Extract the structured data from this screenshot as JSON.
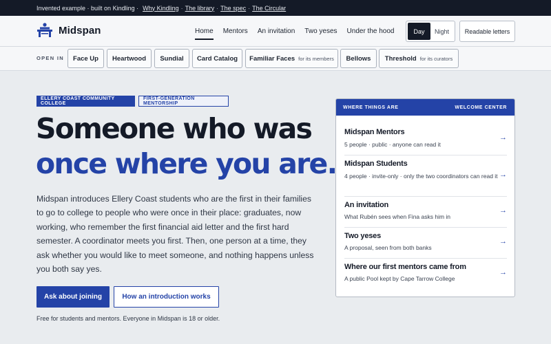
{
  "topbar": {
    "prefix": "Invented example · built on Kindling ·",
    "links": [
      "Why Kindling",
      "The library",
      "The spec",
      "The Circular"
    ],
    "separator": "·"
  },
  "brand": {
    "name": "Midspan",
    "logo_icon": "bench-figure-icon"
  },
  "nav": {
    "items": [
      "Home",
      "Mentors",
      "An invitation",
      "Two yeses",
      "Under the hood"
    ],
    "active": "Home"
  },
  "theme_toggle": {
    "day": "Day",
    "night": "Night",
    "selected": "Day"
  },
  "readable_button": "Readable letters",
  "open_in": {
    "label": "OPEN IN",
    "apps": [
      {
        "name": "Face Up",
        "sub": ""
      },
      {
        "name": "Heartwood",
        "sub": ""
      },
      {
        "name": "Sundial",
        "sub": ""
      },
      {
        "name": "Card Catalog",
        "sub": ""
      },
      {
        "name": "Familiar Faces",
        "sub": "for its members"
      },
      {
        "name": "Bellows",
        "sub": ""
      },
      {
        "name": "Threshold",
        "sub": "for its curators"
      }
    ]
  },
  "hero": {
    "badge_primary": "ELLERY COAST COMMUNITY COLLEGE",
    "badge_secondary": "FIRST-GENERATION MENTORSHIP",
    "headline_line1": "Someone who was",
    "headline_line2": "once where you are.",
    "lead": "Midspan introduces Ellery Coast students who are the first in their families to go to college to people who were once in their place: graduates, now working, who remember the first financial aid letter and the first hard semester. A coordinator meets you first. Then, one person at a time, they ask whether you would like to meet someone, and nothing happens unless you both say yes.",
    "cta_primary": "Ask about joining",
    "cta_secondary": "How an introduction works",
    "fine_print": "Free for students and mentors. Everyone in Midspan is 18 or older."
  },
  "card": {
    "heading_left": "WHERE THINGS ARE",
    "heading_right": "WELCOME CENTER",
    "rows": [
      {
        "title": "Midspan Mentors",
        "desc": "5 people · public · anyone can read it"
      },
      {
        "title": "Midspan Students",
        "desc": "4 people · invite-only · only the two coordinators can read it"
      },
      {
        "title": "An invitation",
        "desc": "What Rubén sees when Fina asks him in"
      },
      {
        "title": "Two yeses",
        "desc": "A proposal, seen from both banks"
      },
      {
        "title": "Where our first mentors came from",
        "desc": "A public Pool kept by Cape Tarrow College"
      }
    ],
    "arrow": "→"
  },
  "colors": {
    "accent": "#2443a7",
    "ink": "#141a27",
    "page_bg": "#e9ecef"
  }
}
